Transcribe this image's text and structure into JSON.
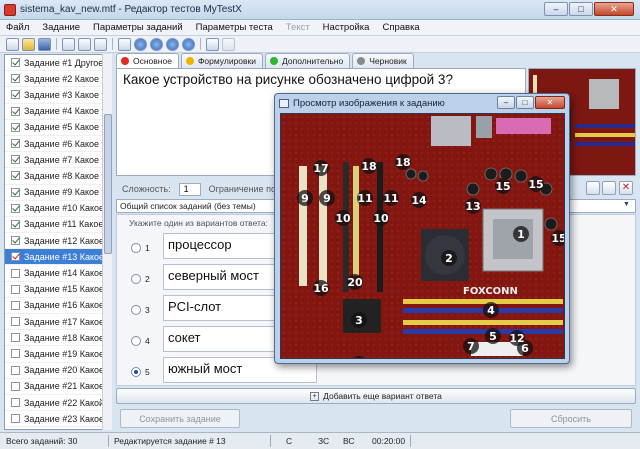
{
  "window": {
    "title": "sistema_kav_new.mtf - Редактор тестов MyTestX",
    "minimize": "–",
    "maximize": "□",
    "close": "✕"
  },
  "menu": [
    "Файл",
    "Задание",
    "Параметры заданий",
    "Параметры теста",
    "Текст",
    "Настройка",
    "Справка"
  ],
  "tasks": [
    {
      "label": "Задание #1 Другое н",
      "state": "on"
    },
    {
      "label": "Задание #2 Какое уст",
      "state": "on"
    },
    {
      "label": "Задание #3 Какое уст",
      "state": "on"
    },
    {
      "label": "Задание #4 Какое уст",
      "state": "on"
    },
    {
      "label": "Задание #5 Какое уст",
      "state": "on"
    },
    {
      "label": "Задание #6 Какое уст",
      "state": "on"
    },
    {
      "label": "Задание #7 Какое уст",
      "state": "on"
    },
    {
      "label": "Задание #8 Какое уст",
      "state": "on"
    },
    {
      "label": "Задание #9 Какое уст",
      "state": "on"
    },
    {
      "label": "Задание #10 Какое у",
      "state": "on"
    },
    {
      "label": "Задание #11 Какое у",
      "state": "on"
    },
    {
      "label": "Задание #12 Какое у",
      "state": "on"
    },
    {
      "label": "Задание #13 Какое у",
      "state": "red",
      "selected": true
    },
    {
      "label": "Задание #14 Какое у",
      "state": "off"
    },
    {
      "label": "Задание #15 Какое у",
      "state": "off"
    },
    {
      "label": "Задание #16 Какое у",
      "state": "off"
    },
    {
      "label": "Задание #17 Какое у",
      "state": "off"
    },
    {
      "label": "Задание #18 Какое у",
      "state": "off"
    },
    {
      "label": "Задание #19 Какое у",
      "state": "off"
    },
    {
      "label": "Задание #20 Какое у",
      "state": "off"
    },
    {
      "label": "Задание #21 Какое у",
      "state": "off"
    },
    {
      "label": "Задание #22 Какой у",
      "state": "off"
    },
    {
      "label": "Задание #23 Какое у",
      "state": "off"
    }
  ],
  "tabs": [
    {
      "label": "Основное",
      "color": "#e02a1f",
      "active": true
    },
    {
      "label": "Формулировки",
      "color": "#f0b400"
    },
    {
      "label": "Дополнительно",
      "color": "#2fb52f"
    },
    {
      "label": "Черновик",
      "color": "#8a8a8a"
    }
  ],
  "question": {
    "text": "Какое устройство на рисунке обозначено цифрой 3?"
  },
  "settings": {
    "difficulty_label": "Сложность:",
    "difficulty_value": "1",
    "time_limit_label": "Ограничение по вре"
  },
  "task_list_combo": "Общий список заданий (без темы)",
  "answers_hint": "Укажите один из вариантов ответа:",
  "answers": [
    {
      "num": "1",
      "text": "процессор",
      "selected": false
    },
    {
      "num": "2",
      "text": "северный мост",
      "selected": false
    },
    {
      "num": "3",
      "text": "PCI-слот",
      "selected": false
    },
    {
      "num": "4",
      "text": "сокет",
      "selected": false
    },
    {
      "num": "5",
      "text": "южный мост",
      "selected": true
    }
  ],
  "buttons": {
    "add_answer": "Добавить еще вариант ответа",
    "save": "Сохранить задание",
    "reset": "Сбросить"
  },
  "status": {
    "total": "Всего заданий: 30",
    "editing": "Редактируется задание # 13",
    "c": "C",
    "zc": "ЗС",
    "bc": "ВС",
    "time": "00:20:00"
  },
  "popup": {
    "title": "Просмотр изображения к заданию",
    "brand": "FOXCONN"
  },
  "board_labels": [
    "1",
    "2",
    "3",
    "4",
    "5",
    "6",
    "7",
    "8",
    "9",
    "9",
    "10",
    "10",
    "11",
    "11",
    "12",
    "13",
    "14",
    "15",
    "15",
    "15",
    "16",
    "17",
    "18",
    "18",
    "19",
    "20"
  ]
}
